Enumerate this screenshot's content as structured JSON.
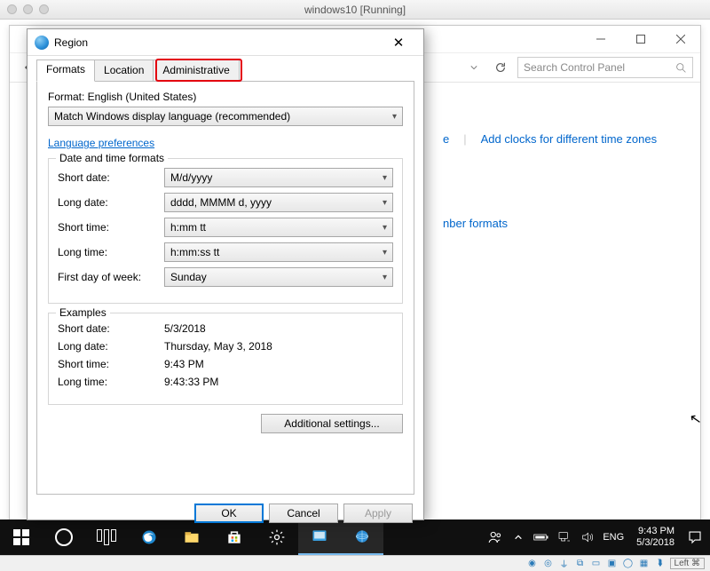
{
  "vm": {
    "title": "windows10 [Running]",
    "left_indicator": "Left ⌘"
  },
  "cp": {
    "search_placeholder": "Search Control Panel",
    "link_change_time_zone": "e",
    "link_add_clocks": "Add clocks for different time zones",
    "link_number_formats": "nber formats"
  },
  "dlg": {
    "title": "Region",
    "tabs": {
      "formats": "Formats",
      "location": "Location",
      "administrative": "Administrative"
    },
    "format_label": "Format: English (United States)",
    "format_combo": "Match Windows display language (recommended)",
    "lang_prefs": "Language preferences",
    "group1_title": "Date and time formats",
    "rows": {
      "short_date_label": "Short date:",
      "short_date_val": "M/d/yyyy",
      "long_date_label": "Long date:",
      "long_date_val": "dddd, MMMM d, yyyy",
      "short_time_label": "Short time:",
      "short_time_val": "h:mm tt",
      "long_time_label": "Long time:",
      "long_time_val": "h:mm:ss tt",
      "first_day_label": "First day of week:",
      "first_day_val": "Sunday"
    },
    "group2_title": "Examples",
    "ex": {
      "short_date_label": "Short date:",
      "short_date_val": "5/3/2018",
      "long_date_label": "Long date:",
      "long_date_val": "Thursday, May 3, 2018",
      "short_time_label": "Short time:",
      "short_time_val": "9:43 PM",
      "long_time_label": "Long time:",
      "long_time_val": "9:43:33 PM"
    },
    "additional": "Additional settings...",
    "ok": "OK",
    "cancel": "Cancel",
    "apply": "Apply"
  },
  "taskbar": {
    "lang": "ENG",
    "time": "9:43 PM",
    "date": "5/3/2018"
  }
}
